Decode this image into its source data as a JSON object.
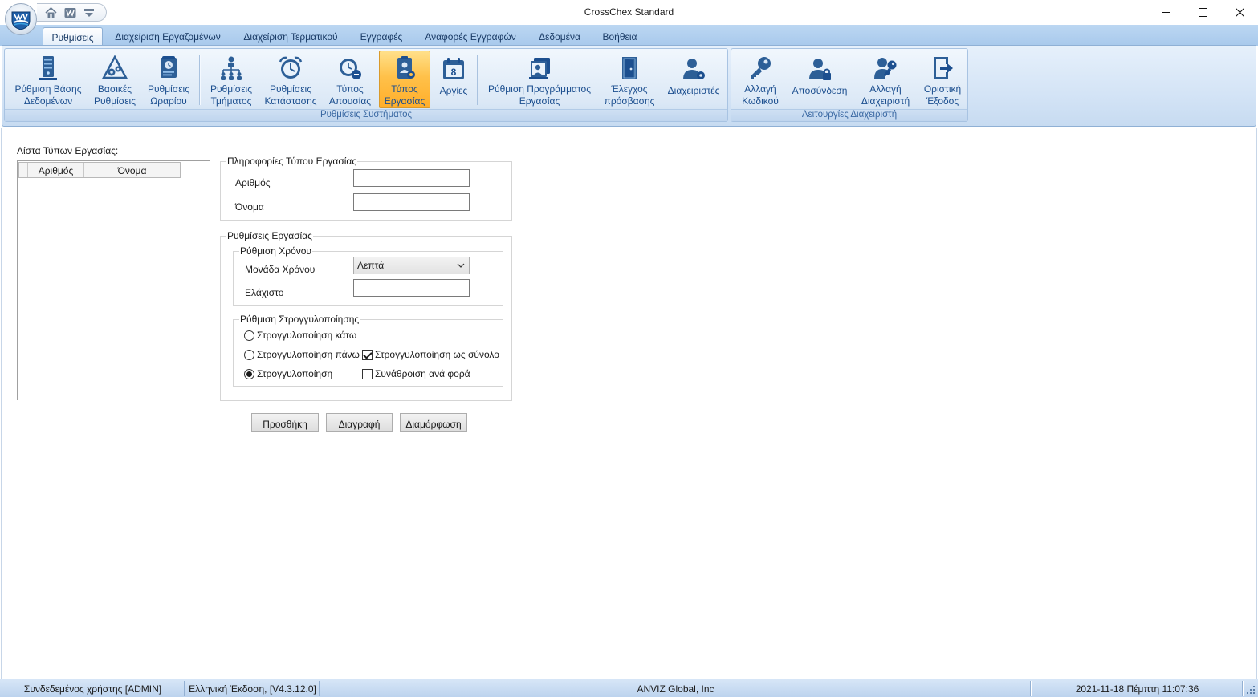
{
  "window": {
    "title": "CrossChex Standard"
  },
  "ribbon_tabs": [
    {
      "label": "Ρυθμίσεις",
      "active": true
    },
    {
      "label": "Διαχείριση Εργαζομένων"
    },
    {
      "label": "Διαχείριση Τερματικού"
    },
    {
      "label": "Εγγραφές"
    },
    {
      "label": "Αναφορές Εγγραφών"
    },
    {
      "label": "Δεδομένα"
    },
    {
      "label": "Βοήθεια"
    }
  ],
  "ribbon_groups": {
    "system_settings": {
      "label": "Ρυθμίσεις Συστήματος",
      "buttons": [
        {
          "label": "Ρύθμιση Βάσης\nΔεδομένων",
          "icon": "database-server-icon"
        },
        {
          "label": "Βασικές\nΡυθμίσεις",
          "icon": "basic-settings-gears-icon"
        },
        {
          "label": "Ρυθμίσεις\nΩραρίου",
          "icon": "schedule-scroll-icon"
        },
        {
          "label": "Ρυθμίσεις\nΤμήματος",
          "icon": "department-hierarchy-icon"
        },
        {
          "label": "Ρυθμίσεις\nΚατάστασης",
          "icon": "alarm-clock-icon"
        },
        {
          "label": "Τύπος\nΑπουσίας",
          "icon": "absence-clock-icon"
        },
        {
          "label": "Τύπος\nΕργασίας",
          "icon": "work-type-badge-icon",
          "active": true
        },
        {
          "label": "Αργίες",
          "icon": "holiday-calendar-icon"
        },
        {
          "label": "Ρύθμιση Προγράμματος\nΕργασίας",
          "icon": "work-schedule-icon"
        },
        {
          "label": "Έλεγχος\nπρόσβασης",
          "icon": "access-door-icon"
        },
        {
          "label": "Διαχειριστές",
          "icon": "administrators-icon"
        }
      ]
    },
    "admin_functions": {
      "label": "Λειτουργίες Διαχειριστή",
      "buttons": [
        {
          "label": "Αλλαγή\nΚωδικού",
          "icon": "key-icon"
        },
        {
          "label": "Αποσύνδεση",
          "icon": "logout-lock-user-icon"
        },
        {
          "label": "Αλλαγή\nΔιαχειριστή",
          "icon": "change-admin-key-icon"
        },
        {
          "label": "Οριστική\nΈξοδος",
          "icon": "exit-door-icon"
        }
      ]
    }
  },
  "work_type_list": {
    "title": "Λίστα Τύπων Εργασίας:",
    "columns": [
      "Αριθμός",
      "Όνομα"
    ],
    "rows": []
  },
  "work_type_info": {
    "legend": "Πληροφορίες Τύπου Εργασίας",
    "number_label": "Αριθμός",
    "number_value": "",
    "name_label": "Όνομα",
    "name_value": ""
  },
  "work_settings": {
    "legend": "Ρυθμίσεις Εργασίας",
    "time_setting": {
      "legend": "Ρύθμιση Χρόνου",
      "time_unit_label": "Μονάδα Χρόνου",
      "time_unit_value": "Λεπτά",
      "minimum_label": "Ελάχιστο",
      "minimum_value": ""
    },
    "rounding_setting": {
      "legend": "Ρύθμιση Στρογγυλοποίησης",
      "round_down": "Στρογγυλοποίηση κάτω",
      "round_up": "Στρογγυλοποίηση πάνω",
      "round": "Στρογγυλοποίηση",
      "round_total": "Στρογγυλοποίηση ως σύνολο",
      "sum_each_time": "Συνάθροιση ανά φορά",
      "selected_radio": "round",
      "round_total_checked": true,
      "sum_each_time_checked": false
    }
  },
  "actions": {
    "add": "Προσθήκη",
    "delete": "Διαγραφή",
    "edit": "Διαμόρφωση"
  },
  "status_bar": {
    "user": "Συνδεδεμένος χρήστης [ADMIN]",
    "version": "Ελληνική Έκδοση, [V4.3.12.0]",
    "company": "ANVIZ Global, Inc",
    "datetime": "2021-11-18 Πέμπτη 11:07:36"
  },
  "colors": {
    "ribbon_accent": "#1c4f8f",
    "active_button": "#ffc14a",
    "tab_bar": "#bcd7f2"
  }
}
